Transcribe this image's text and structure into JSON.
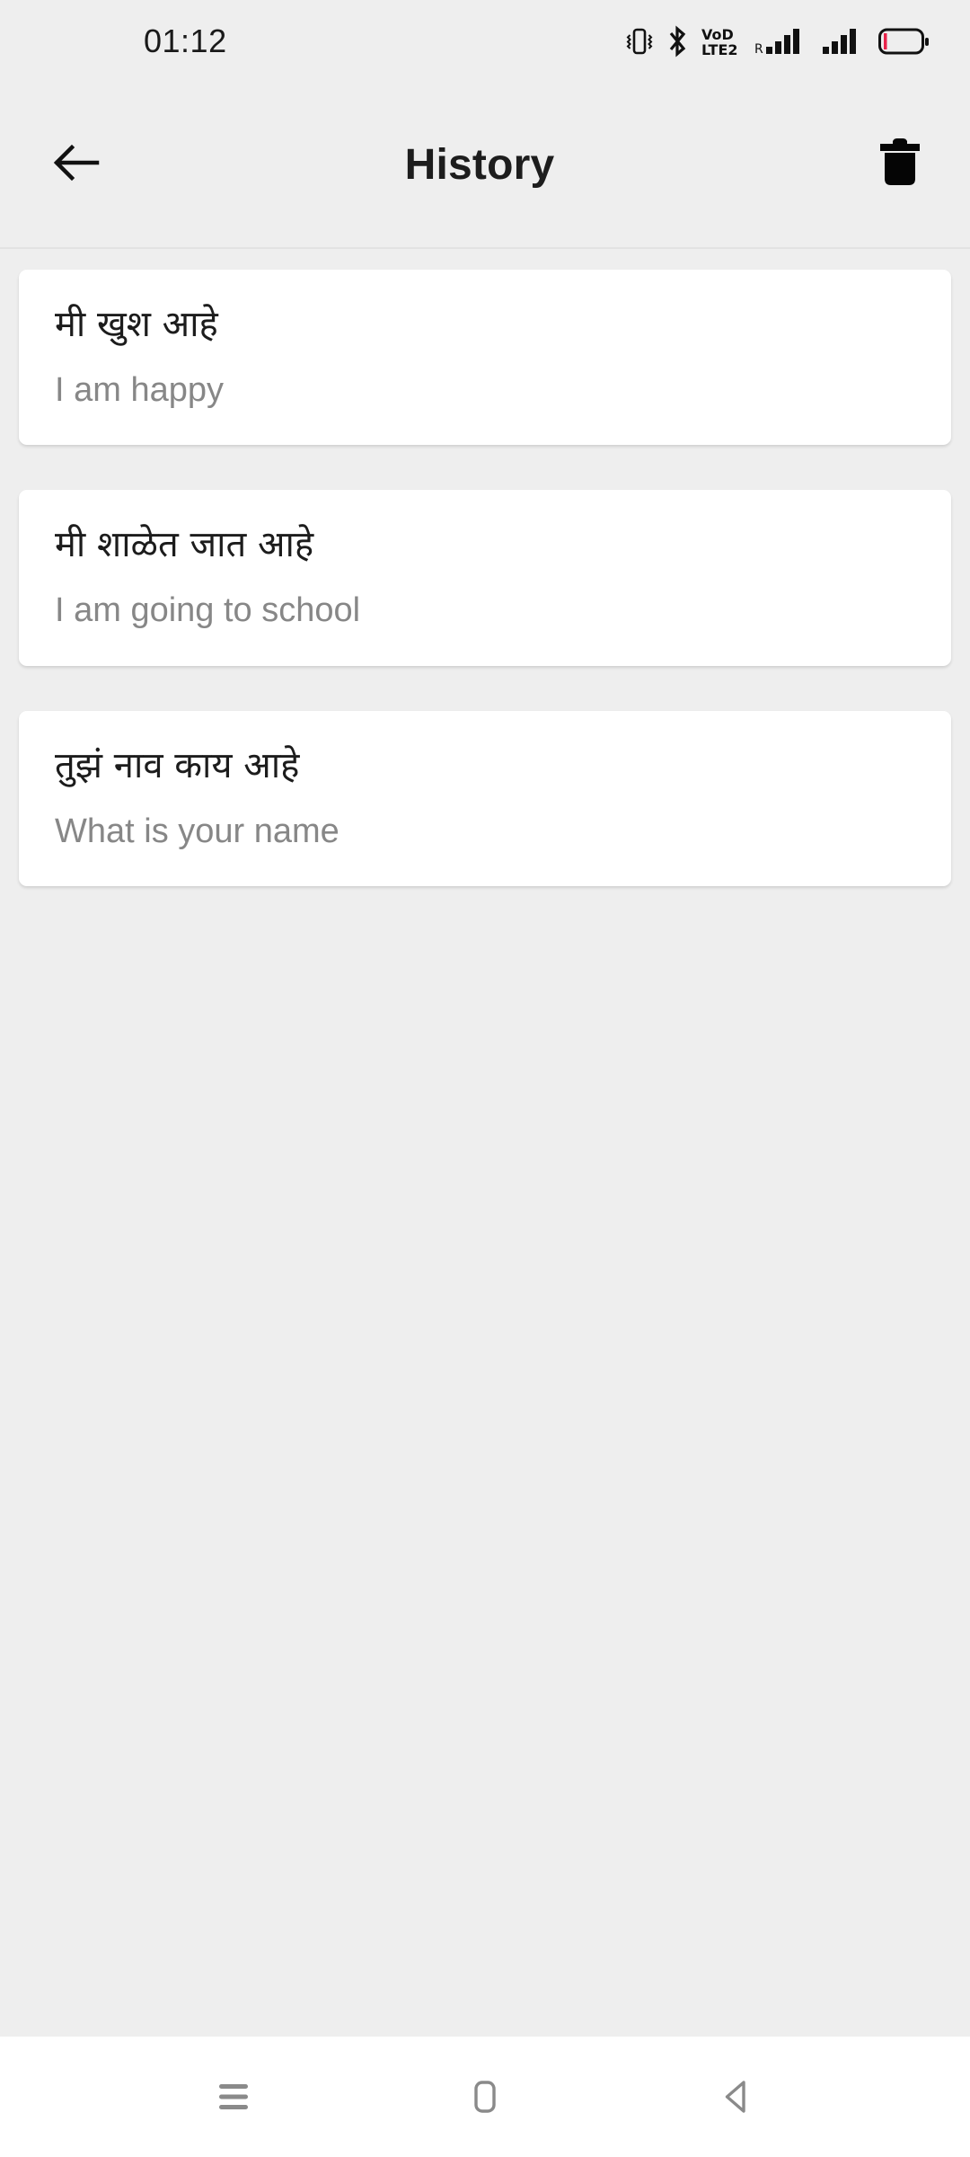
{
  "status_bar": {
    "clock": "01:12",
    "icons": [
      {
        "name": "vibrate-icon"
      },
      {
        "name": "bluetooth-icon"
      },
      {
        "name": "volte-icon",
        "label_top": "VoD",
        "label_bottom": "LTE2"
      },
      {
        "name": "signal-roaming-icon",
        "label": "R"
      },
      {
        "name": "signal-bars-icon"
      },
      {
        "name": "battery-icon"
      }
    ]
  },
  "app_bar": {
    "back_label": "back-arrow",
    "title": "History",
    "delete_label": "delete-all"
  },
  "history": {
    "items": [
      {
        "source": "मी खुश आहे",
        "translation": "I am happy"
      },
      {
        "source": "मी शाळेत जात आहे",
        "translation": "I am going to school"
      },
      {
        "source": "तुझं नाव काय आहे",
        "translation": "What is your name"
      }
    ]
  },
  "nav_bar": {
    "recents_label": "recent-apps",
    "home_label": "home",
    "back_label": "back"
  },
  "colors": {
    "background": "#eeeeee",
    "card": "#ffffff",
    "source_text": "#1c1c1c",
    "translation_text": "#878787",
    "title_text": "#1d1d1d",
    "nav_icon": "#8a8a8a",
    "battery_low": "#e8234a"
  }
}
